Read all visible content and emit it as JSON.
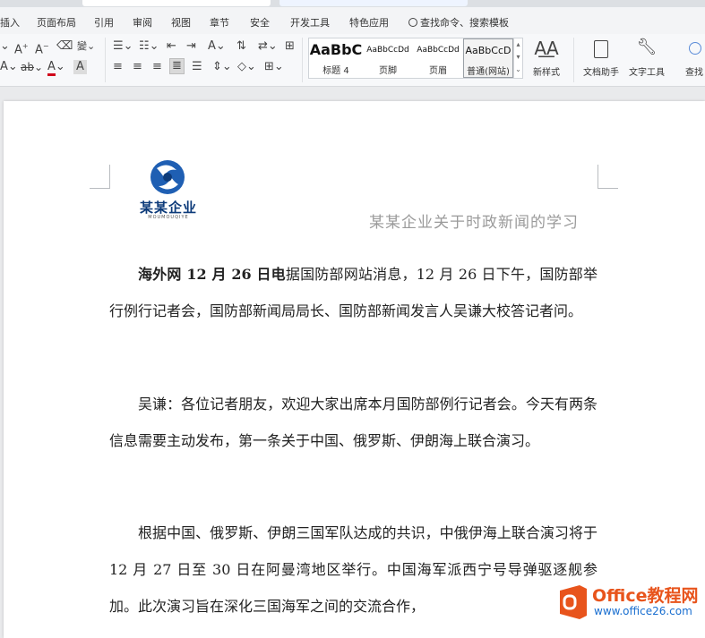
{
  "menubar": {
    "items": [
      "插入",
      "页面布局",
      "引用",
      "审阅",
      "视图",
      "章节",
      "安全",
      "开发工具",
      "特色应用"
    ],
    "search_label": "查找命令、搜索模板"
  },
  "ribbon": {
    "styles": [
      {
        "sample": "AaBbC",
        "name": "标题 4"
      },
      {
        "sample": "AaBbCcDd",
        "name": "页脚"
      },
      {
        "sample": "AaBbCcDd",
        "name": "页眉"
      },
      {
        "sample": "AaBbCcD",
        "name": "普通(网站)"
      }
    ],
    "new_style_label": "新样式",
    "doc_assistant_label": "文档助手",
    "text_tools_label": "文字工具",
    "find_label": "查找"
  },
  "document": {
    "logo_text": "某某企业",
    "logo_subtext": "MOUMOUQIYE",
    "header_title": "某某企业关于时政新闻的学习",
    "paragraphs": [
      {
        "lead": "海外网 12 月 26 日电",
        "text": "据国防部网站消息，12 月 26 日下午，国防部举行例行记者会，国防部新闻局局长、国防部新闻发言人吴谦大校答记者问。"
      },
      {
        "lead": "",
        "text": "吴谦：各位记者朋友，欢迎大家出席本月国防部例行记者会。今天有两条信息需要主动发布，第一条关于中国、俄罗斯、伊朗海上联合演习。"
      },
      {
        "lead": "",
        "text": "根据中国、俄罗斯、伊朗三国军队达成的共识，中俄伊海上联合演习将于 12 月 27 日至 30 日在阿曼湾地区举行。中国海军派西宁号导弹驱逐舰参加。此次演习旨在深化三国海军之间的交流合作，"
      }
    ]
  },
  "watermark": {
    "brand": "Office教程网",
    "url": "www.office26.com"
  },
  "colors": {
    "accent_blue": "#2b6fd6",
    "watermark_orange": "#e8541c",
    "watermark_blue": "#1a6fd0"
  }
}
